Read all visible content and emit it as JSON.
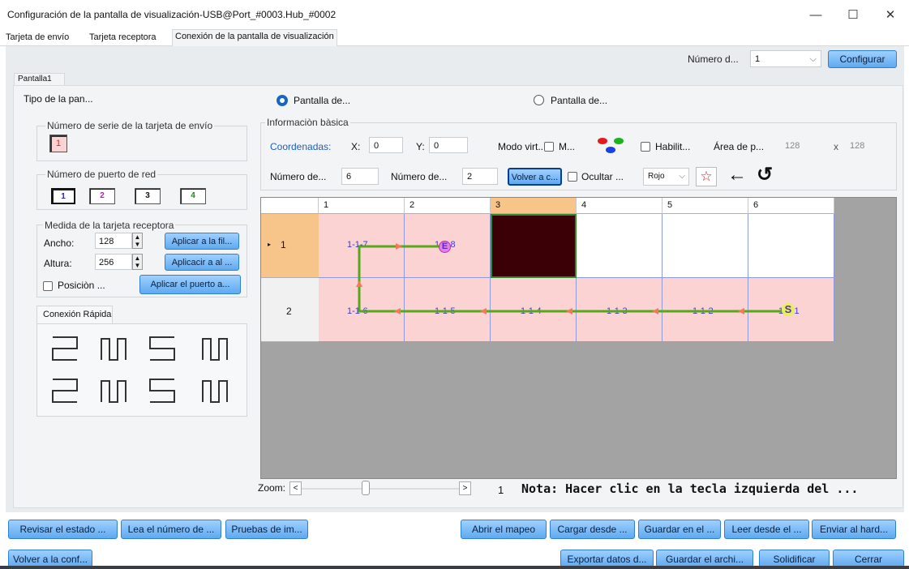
{
  "window": {
    "title": "Configuración de la pantalla de visualización-USB@Port_#0003.Hub_#0002",
    "minimize": "—",
    "maximize": "☐",
    "close": "✕"
  },
  "tabs": [
    {
      "label": "Tarjeta de envío"
    },
    {
      "label": "Tarjeta receptora"
    },
    {
      "label": "Conexión de la pantalla de visualización"
    }
  ],
  "top": {
    "numero_label": "Número d...",
    "numero_value": "1",
    "configure": "Configurar"
  },
  "screen_tab": "Pantalla1",
  "type": {
    "label": "Tipo de la pan...",
    "opt1": "Pantalla de...",
    "opt2": "Pantalla de..."
  },
  "send_card": {
    "title": "Número de serie de la tarjeta de envío",
    "value": "1"
  },
  "ports": {
    "title": "Número de puerto de red",
    "items": [
      "1",
      "2",
      "3",
      "4"
    ],
    "colors": [
      "#2a2ab0",
      "#b01fb0",
      "#111111",
      "#1a8a1a"
    ]
  },
  "receiver": {
    "title": "Medida de la tarjeta receptora",
    "width_label": "Ancho:",
    "width_value": "128",
    "height_label": "Altura:",
    "height_value": "256",
    "apply_row": "Aplicar a la fil...",
    "apply_col": "Aplicacir a al ...",
    "position_label": "Posiciòn ...",
    "apply_port": "Aplicar el puerto a..."
  },
  "quick": {
    "title": "Conexión Rápida"
  },
  "basic": {
    "title": "Informaciòn bàsica",
    "coords_label": "Coordenadas:",
    "x_label": "X:",
    "x_value": "0",
    "y_label": "Y:",
    "y_value": "0",
    "virtual_label": "Modo virt...",
    "m_label": "M...",
    "enable_label": "Habilit...",
    "area_label": "Área de p...",
    "area_w": "128",
    "area_x": "x",
    "area_h": "128",
    "rows_label": "Número de...",
    "rows_value": "6",
    "cols_label": "Número de...",
    "cols_value": "2",
    "back_button": "Volver a c...",
    "hide_label": "Ocultar ...",
    "color_select": "Rojo"
  },
  "grid": {
    "col_headers": [
      "1",
      "2",
      "3",
      "4",
      "5",
      "6"
    ],
    "row_headers": [
      "1",
      "2"
    ],
    "row1": [
      "1-1-7",
      "1-1-8",
      "",
      "",
      "",
      ""
    ],
    "row2": [
      "1-1-6",
      "1-1-5",
      "1-1-4",
      "1-1-3",
      "1-1-2",
      "1-1-1"
    ],
    "start_mark": "S",
    "end_mark": "E"
  },
  "zoom": {
    "label": "Zoom:",
    "left": "<",
    "right": ">",
    "value": "1",
    "note": "Nota: Hacer clic en la tecla izquierda del ..."
  },
  "footer1": {
    "left": [
      "Revisar el estado ...",
      "Lea el número de ...",
      "Pruebas de im..."
    ],
    "right": [
      "Abrir el mapeo",
      "Cargar desde ...",
      "Guardar en el ...",
      "Leer desde el ...",
      "Enviar al hard..."
    ]
  },
  "footer2": {
    "left": "Volver a la conf...",
    "right": [
      "Exportar datos d...",
      "Guardar el archi...",
      "Solidificar",
      "Cerrar"
    ]
  },
  "colors": {
    "accent": "#5faaf0",
    "selected_row": "#f7c48a",
    "cell_pink": "#fbd3d3",
    "path": "#5aa51b",
    "arrow": "#f07a5a"
  }
}
